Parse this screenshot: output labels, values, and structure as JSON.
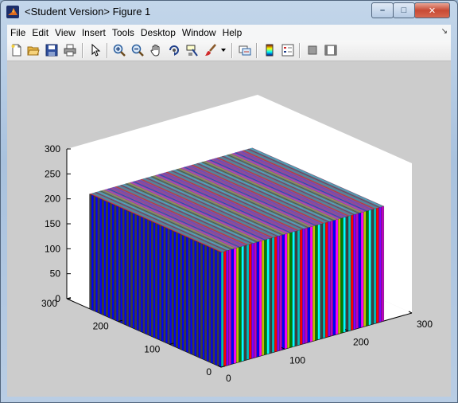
{
  "window": {
    "title": "<Student Version> Figure 1",
    "controls": {
      "minimize": "–",
      "maximize": "□",
      "close": "✕"
    }
  },
  "menu": {
    "items": [
      {
        "id": "file",
        "label": "File"
      },
      {
        "id": "edit",
        "label": "Edit"
      },
      {
        "id": "view",
        "label": "View"
      },
      {
        "id": "insert",
        "label": "Insert"
      },
      {
        "id": "tools",
        "label": "Tools"
      },
      {
        "id": "desktop",
        "label": "Desktop"
      },
      {
        "id": "window",
        "label": "Window"
      },
      {
        "id": "help",
        "label": "Help"
      }
    ]
  },
  "toolbar": {
    "icons": [
      "new-figure-icon",
      "open-file-icon",
      "save-icon",
      "print-icon",
      "edit-plot-arrow-icon",
      "zoom-in-icon",
      "zoom-out-icon",
      "pan-hand-icon",
      "rotate-3d-icon",
      "data-cursor-icon",
      "brush-icon",
      "brush-dropdown-icon",
      "link-plot-icon",
      "colorbar-icon",
      "legend-icon",
      "hide-plot-tools-icon",
      "show-plot-tools-icon"
    ]
  },
  "colors": {
    "bar_palette": [
      "#ff0000",
      "#0000ff",
      "#008000",
      "#00bfbf",
      "#bf00bf",
      "#bfbf00",
      "#404040",
      "#8000ff",
      "#ff00ff",
      "#00ffff"
    ],
    "axes_background": "#ffffff",
    "figure_background": "#cccccc"
  },
  "chart_data": {
    "type": "bar3",
    "z_ticks": [
      "0",
      "50",
      "100",
      "150",
      "200",
      "250",
      "300"
    ],
    "y_ticks": [
      "0",
      "100",
      "200",
      "300"
    ],
    "x_ticks": [
      "0",
      "100",
      "200",
      "300"
    ],
    "zlim": [
      0,
      300
    ],
    "xlim": [
      0,
      300
    ],
    "ylim": [
      0,
      300
    ],
    "bar_height": 230,
    "block_extent": [
      0,
      256
    ],
    "grid": false
  }
}
